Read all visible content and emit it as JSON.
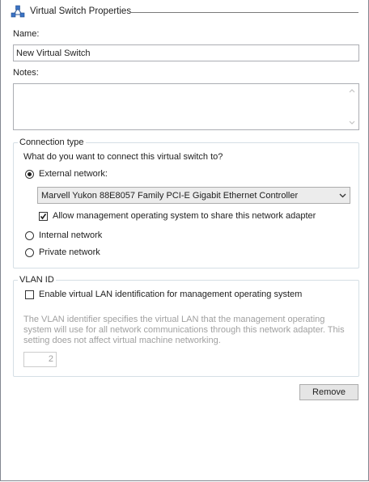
{
  "header": {
    "title": "Virtual Switch Properties",
    "icon": "network-switch-icon"
  },
  "name_field": {
    "label": "Name:",
    "value": "New Virtual Switch"
  },
  "notes_field": {
    "label": "Notes:",
    "value": ""
  },
  "connection": {
    "caption": "Connection type",
    "question": "What do you want to connect this virtual switch to?",
    "options": [
      {
        "label": "External network:",
        "selected": true
      },
      {
        "label": "Internal network",
        "selected": false
      },
      {
        "label": "Private network",
        "selected": false
      }
    ],
    "adapter_selected": "Marvell Yukon 88E8057 Family PCI-E Gigabit Ethernet Controller",
    "allow_mgmt": {
      "label": "Allow management operating system to share this network adapter",
      "checked": true
    }
  },
  "vlan": {
    "caption": "VLAN ID",
    "enable": {
      "label": "Enable virtual LAN identification for management operating system",
      "checked": false
    },
    "description": "The VLAN identifier specifies the virtual LAN that the management operating system will use for all network communications through this network adapter. This setting does not affect virtual machine networking.",
    "value": "2"
  },
  "actions": {
    "remove_label": "Remove"
  }
}
